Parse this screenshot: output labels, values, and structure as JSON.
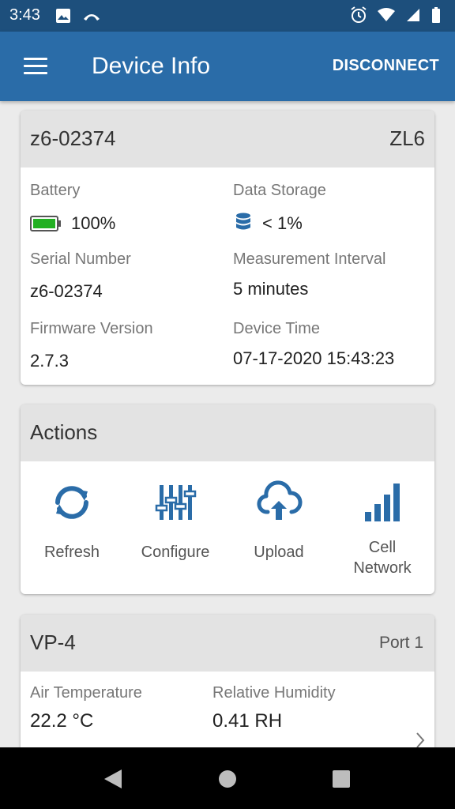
{
  "status_bar": {
    "time": "3:43"
  },
  "app_bar": {
    "title": "Device Info",
    "action": "DISCONNECT"
  },
  "device_card": {
    "name": "z6-02374",
    "model": "ZL6",
    "battery_label": "Battery",
    "battery_value": "100%",
    "storage_label": "Data Storage",
    "storage_value": "< 1%",
    "serial_label": "Serial Number",
    "serial_value": "z6-02374",
    "interval_label": "Measurement Interval",
    "interval_value": "5 minutes",
    "firmware_label": "Firmware Version",
    "firmware_value": "2.7.3",
    "time_label": "Device Time",
    "time_value": "07-17-2020 15:43:23"
  },
  "actions_card": {
    "title": "Actions",
    "items": [
      {
        "label": "Refresh",
        "icon": "refresh-icon"
      },
      {
        "label": "Configure",
        "icon": "sliders-icon"
      },
      {
        "label": "Upload",
        "icon": "cloud-upload-icon"
      },
      {
        "label": "Cell Network",
        "icon": "signal-bars-icon"
      }
    ]
  },
  "sensor_card": {
    "name": "VP-4",
    "port": "Port 1",
    "air_temp_label": "Air Temperature",
    "air_temp_value": "22.2 °C",
    "humidity_label": "Relative Humidity",
    "humidity_value": "0.41 RH"
  },
  "colors": {
    "app_bar": "#2a6ca8",
    "status_bar": "#1d4f7c",
    "icon_blue": "#2a6ca8",
    "battery_green": "#22b022"
  }
}
